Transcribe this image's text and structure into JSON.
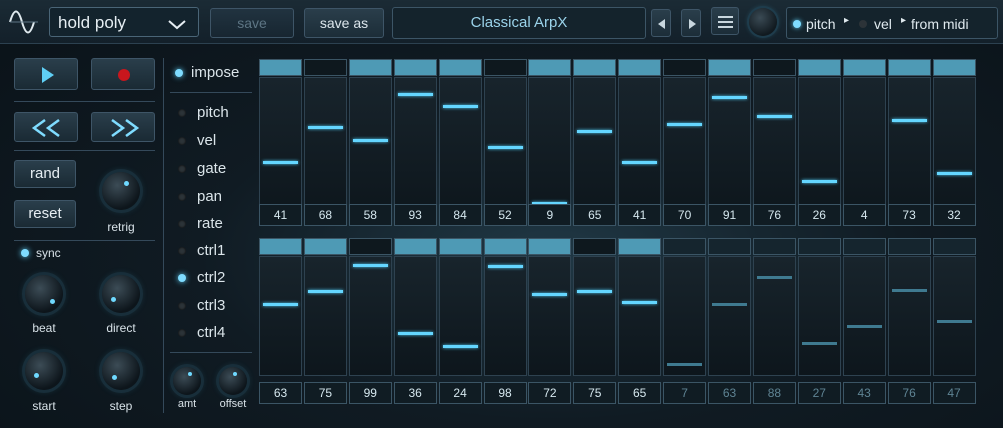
{
  "topbar": {
    "mode_label": "hold poly",
    "save_label": "save",
    "save_as_label": "save as",
    "patch_name": "Classical ArpX",
    "routing": [
      "pitch",
      "vel",
      "from midi"
    ]
  },
  "left": {
    "rand_label": "rand",
    "reset_label": "reset",
    "retrig_label": "retrig",
    "sync_label": "sync",
    "beat_label": "beat",
    "direct_label": "direct",
    "start_label": "start",
    "step_label": "step"
  },
  "middle": {
    "impose_label": "impose",
    "options": [
      {
        "label": "pitch",
        "on": false
      },
      {
        "label": "vel",
        "on": false
      },
      {
        "label": "gate",
        "on": false
      },
      {
        "label": "pan",
        "on": false
      },
      {
        "label": "rate",
        "on": false
      },
      {
        "label": "ctrl1",
        "on": false
      },
      {
        "label": "ctrl2",
        "on": true
      },
      {
        "label": "ctrl3",
        "on": false
      },
      {
        "label": "ctrl4",
        "on": false
      }
    ],
    "amt_label": "amt",
    "offset_label": "offset"
  },
  "grid": {
    "top_values": [
      "41",
      "68",
      "58",
      "93",
      "84",
      "52",
      "9",
      "65",
      "41",
      "70",
      "91",
      "76",
      "26",
      "4",
      "73",
      "32"
    ],
    "top_gates": [
      true,
      false,
      true,
      true,
      true,
      false,
      true,
      true,
      true,
      false,
      true,
      false,
      true,
      true,
      true,
      true
    ],
    "bottom_values": [
      "63",
      "75",
      "99",
      "36",
      "24",
      "98",
      "72",
      "75",
      "65",
      "7",
      "63",
      "88",
      "27",
      "43",
      "76",
      "47"
    ],
    "bottom_gates": [
      true,
      true,
      false,
      true,
      true,
      true,
      true,
      false,
      true,
      false,
      false,
      false,
      false,
      false,
      false,
      false
    ],
    "bottom_active_steps": 9
  },
  "colors": {
    "accent": "#64d6ff",
    "gate_on": "#4e9ab5",
    "gate_dim": "#234452"
  }
}
